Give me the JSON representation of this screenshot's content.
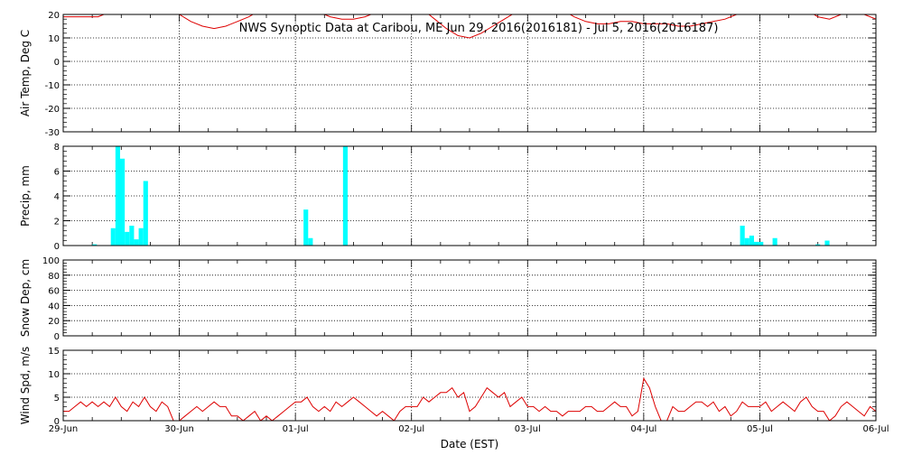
{
  "chart_data": {
    "title": "NWS Synoptic Data at Caribou, ME   Jun 29, 2016(2016181) - Jul  5, 2016(2016187)",
    "type": "line",
    "xlabel": "Date (EST)",
    "x_ticks": [
      "29-Jun",
      "30-Jun",
      "01-Jul",
      "02-Jul",
      "03-Jul",
      "04-Jul",
      "05-Jul",
      "06-Jul"
    ],
    "x_range_days": [
      0,
      7
    ],
    "line_color": "#dd0000",
    "bar_color": "#00ffff",
    "grid": "dotted, at day boundaries",
    "panels": [
      {
        "id": "air_temp",
        "type": "line",
        "ylabel": "Air Temp, Deg C",
        "ylim": [
          -30,
          20
        ],
        "yticks": [
          "20",
          "10",
          "0",
          "-10",
          "-20",
          "-30"
        ],
        "x": [
          0.0,
          0.1,
          0.2,
          0.3,
          0.4,
          0.5,
          0.6,
          0.7,
          0.8,
          0.9,
          1.0,
          1.1,
          1.2,
          1.3,
          1.4,
          1.5,
          1.6,
          1.7,
          1.8,
          1.9,
          2.0,
          2.1,
          2.2,
          2.3,
          2.4,
          2.5,
          2.6,
          2.7,
          2.8,
          2.9,
          3.0,
          3.1,
          3.2,
          3.3,
          3.4,
          3.5,
          3.6,
          3.7,
          3.8,
          3.9,
          4.0,
          4.1,
          4.2,
          4.3,
          4.4,
          4.5,
          4.6,
          4.7,
          4.8,
          4.9,
          5.0,
          5.1,
          5.2,
          5.3,
          5.4,
          5.5,
          5.6,
          5.7,
          5.8,
          5.9,
          6.0,
          6.1,
          6.2,
          6.3,
          6.4,
          6.5,
          6.6,
          6.7,
          6.8,
          6.9,
          7.0
        ],
        "values": [
          19,
          19,
          19,
          19,
          21,
          23,
          25,
          25,
          24,
          22,
          20,
          17,
          15,
          14,
          15,
          17,
          19,
          22,
          24,
          25,
          25,
          23,
          21,
          19,
          18,
          18,
          19,
          21,
          23,
          24,
          24,
          22,
          18,
          14,
          11,
          10,
          12,
          15,
          18,
          21,
          24,
          25,
          24,
          22,
          19,
          17,
          16,
          16,
          17,
          17,
          16,
          16,
          16,
          15,
          15,
          16,
          17,
          18,
          20,
          22,
          24,
          25,
          25,
          24,
          22,
          19,
          18,
          20,
          22,
          20,
          18
        ]
      },
      {
        "id": "precip",
        "type": "bar",
        "ylabel": "Precip, mm",
        "ylim": [
          0,
          8
        ],
        "yticks": [
          "8",
          "6",
          "4",
          "2",
          "0"
        ],
        "bar_width_days": 0.04,
        "x": [
          0.27,
          0.43,
          0.47,
          0.51,
          0.55,
          0.59,
          0.63,
          0.67,
          0.71,
          2.09,
          2.13,
          2.43,
          5.85,
          5.89,
          5.93,
          5.97,
          6.01,
          6.13,
          6.5,
          6.58
        ],
        "values": [
          0.1,
          1.4,
          8.2,
          7.0,
          1.1,
          1.6,
          0.5,
          1.4,
          5.2,
          2.9,
          0.6,
          8.2,
          1.6,
          0.6,
          0.8,
          0.3,
          0.3,
          0.6,
          0.1,
          0.4
        ]
      },
      {
        "id": "snow_depth",
        "type": "line",
        "ylabel": "Snow Dep, cm",
        "ylim": [
          0,
          100
        ],
        "yticks": [
          "100",
          "80",
          "60",
          "40",
          "20",
          "0"
        ],
        "x": [],
        "values": []
      },
      {
        "id": "wind_speed",
        "type": "line",
        "ylabel": "Wind Spd, m/s",
        "ylim": [
          0,
          15
        ],
        "yticks": [
          "15",
          "10",
          "5",
          "0"
        ],
        "x": [
          0.0,
          0.05,
          0.1,
          0.15,
          0.2,
          0.25,
          0.3,
          0.35,
          0.4,
          0.45,
          0.5,
          0.55,
          0.6,
          0.65,
          0.7,
          0.75,
          0.8,
          0.85,
          0.9,
          0.95,
          1.0,
          1.05,
          1.1,
          1.15,
          1.2,
          1.25,
          1.3,
          1.35,
          1.4,
          1.45,
          1.5,
          1.55,
          1.6,
          1.65,
          1.7,
          1.75,
          1.8,
          1.85,
          1.9,
          1.95,
          2.0,
          2.05,
          2.1,
          2.15,
          2.2,
          2.25,
          2.3,
          2.35,
          2.4,
          2.45,
          2.5,
          2.55,
          2.6,
          2.65,
          2.7,
          2.75,
          2.8,
          2.85,
          2.9,
          2.95,
          3.0,
          3.05,
          3.1,
          3.15,
          3.2,
          3.25,
          3.3,
          3.35,
          3.4,
          3.45,
          3.5,
          3.55,
          3.6,
          3.65,
          3.7,
          3.75,
          3.8,
          3.85,
          3.9,
          3.95,
          4.0,
          4.05,
          4.1,
          4.15,
          4.2,
          4.25,
          4.3,
          4.35,
          4.4,
          4.45,
          4.5,
          4.55,
          4.6,
          4.65,
          4.7,
          4.75,
          4.8,
          4.85,
          4.9,
          4.95,
          5.0,
          5.05,
          5.1,
          5.15,
          5.2,
          5.25,
          5.3,
          5.35,
          5.4,
          5.45,
          5.5,
          5.55,
          5.6,
          5.65,
          5.7,
          5.75,
          5.8,
          5.85,
          5.9,
          5.95,
          6.0,
          6.05,
          6.1,
          6.15,
          6.2,
          6.25,
          6.3,
          6.35,
          6.4,
          6.45,
          6.5,
          6.55,
          6.6,
          6.65,
          6.7,
          6.75,
          6.8,
          6.85,
          6.9,
          6.95,
          7.0
        ],
        "values": [
          2,
          2,
          3,
          4,
          3,
          4,
          3,
          4,
          3,
          5,
          3,
          2,
          4,
          3,
          5,
          3,
          2,
          4,
          3,
          0,
          0,
          1,
          2,
          3,
          2,
          3,
          4,
          3,
          3,
          1,
          1,
          0,
          1,
          2,
          0,
          1,
          0,
          1,
          2,
          3,
          4,
          4,
          5,
          3,
          2,
          3,
          2,
          4,
          3,
          4,
          5,
          4,
          3,
          2,
          1,
          2,
          1,
          0,
          2,
          3,
          3,
          3,
          5,
          4,
          5,
          6,
          6,
          7,
          5,
          6,
          2,
          3,
          5,
          7,
          6,
          5,
          6,
          3,
          4,
          5,
          3,
          3,
          2,
          3,
          2,
          2,
          1,
          2,
          2,
          2,
          3,
          3,
          2,
          2,
          3,
          4,
          3,
          3,
          1,
          2,
          9,
          7,
          3,
          0,
          0,
          3,
          2,
          2,
          3,
          4,
          4,
          3,
          4,
          2,
          3,
          1,
          2,
          4,
          3,
          3,
          3,
          4,
          2,
          3,
          4,
          3,
          2,
          4,
          5,
          3,
          2,
          2,
          0,
          1,
          3,
          4,
          3,
          2,
          1,
          3,
          2
        ]
      }
    ]
  }
}
